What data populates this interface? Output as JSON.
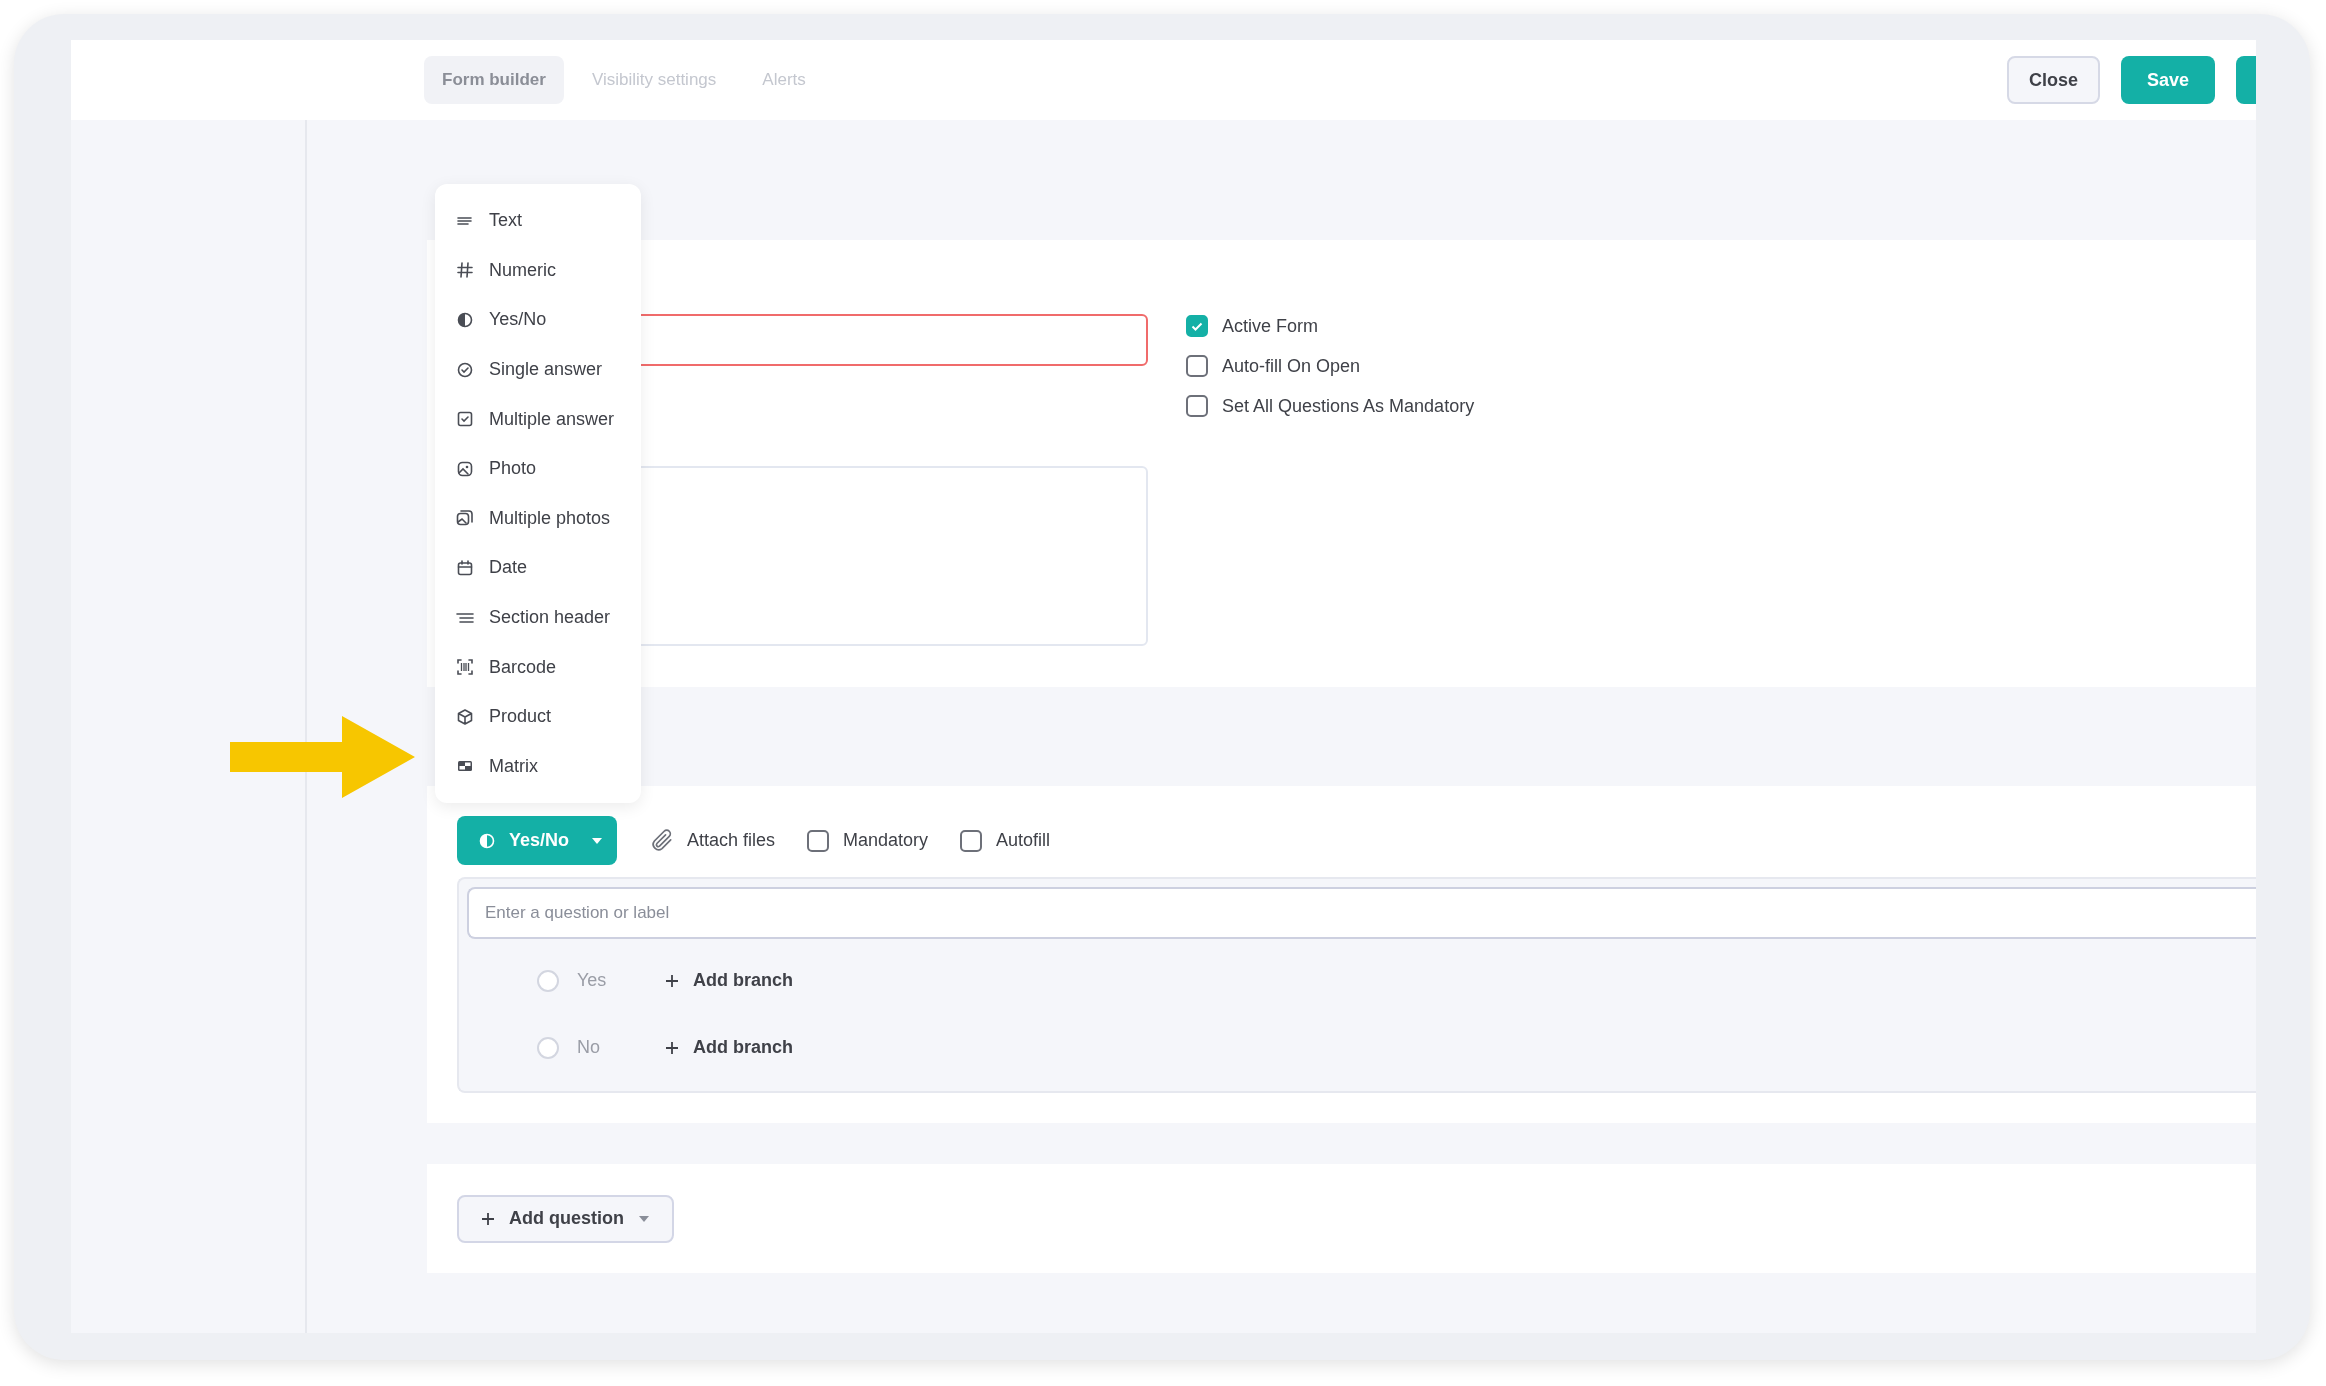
{
  "tabs": [
    {
      "label": "Form builder",
      "selected": true
    },
    {
      "label": "Visibility settings",
      "selected": false
    },
    {
      "label": "Alerts",
      "selected": false
    }
  ],
  "actions": [
    {
      "kind": "outline",
      "label": "Close"
    },
    {
      "kind": "primary",
      "label": "Save"
    },
    {
      "kind": "primary_cut"
    }
  ],
  "form_options": [
    {
      "label": "Active Form",
      "checked": true
    },
    {
      "label": "Auto-fill On Open",
      "checked": false
    },
    {
      "label": "Set All Questions As Mandatory",
      "checked": false
    }
  ],
  "type_menu": [
    {
      "kind": "text",
      "label": "Text"
    },
    {
      "kind": "numeric",
      "label": "Numeric"
    },
    {
      "kind": "yes_no",
      "label": "Yes/No"
    },
    {
      "kind": "single",
      "label": "Single answer"
    },
    {
      "kind": "multiple",
      "label": "Multiple answer"
    },
    {
      "kind": "photo",
      "label": "Photo"
    },
    {
      "kind": "photos",
      "label": "Multiple photos"
    },
    {
      "kind": "date",
      "label": "Date"
    },
    {
      "kind": "section",
      "label": "Section header"
    },
    {
      "kind": "barcode",
      "label": "Barcode"
    },
    {
      "kind": "product",
      "label": "Product"
    },
    {
      "kind": "matrix",
      "label": "Matrix"
    }
  ],
  "question": {
    "type_button": {
      "kind": "yes_no",
      "label": "Yes/No"
    },
    "tools": [
      {
        "kind": "attach",
        "label": "Attach files"
      },
      {
        "kind": "checkbox",
        "label": "Mandatory",
        "checked": false
      },
      {
        "kind": "checkbox",
        "label": "Autofill",
        "checked": false
      }
    ],
    "input": {
      "placeholder": "Enter a question or label"
    },
    "answers": [
      {
        "label": "Yes",
        "selected": false,
        "action": "Add branch"
      },
      {
        "label": "No",
        "selected": false,
        "action": "Add branch"
      }
    ]
  },
  "add_question": {
    "label": "Add question"
  }
}
